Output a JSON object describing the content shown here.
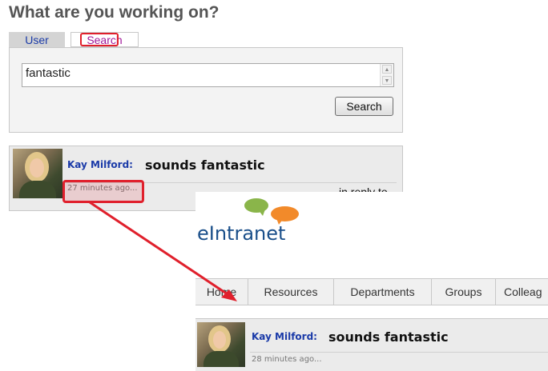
{
  "heading": "What are you working on?",
  "tabs": {
    "user": "User",
    "search": "Search"
  },
  "search": {
    "value": "fantastic",
    "button_label": "Search"
  },
  "post": {
    "author": "Kay Milford:",
    "message": "sounds fantastic",
    "time": "27 minutes ago...",
    "reply": "in reply to"
  },
  "intranet": {
    "logo": "eIntranet",
    "nav": [
      "Home",
      "Resources",
      "Departments",
      "Groups",
      "Colleag"
    ],
    "post": {
      "author": "Kay Milford:",
      "message": "sounds fantastic",
      "time": "28 minutes ago..."
    }
  },
  "colors": {
    "highlight": "#e0202c",
    "link": "#1a3aa8",
    "logo_green": "#8ab54a",
    "logo_orange": "#f28a2a"
  }
}
